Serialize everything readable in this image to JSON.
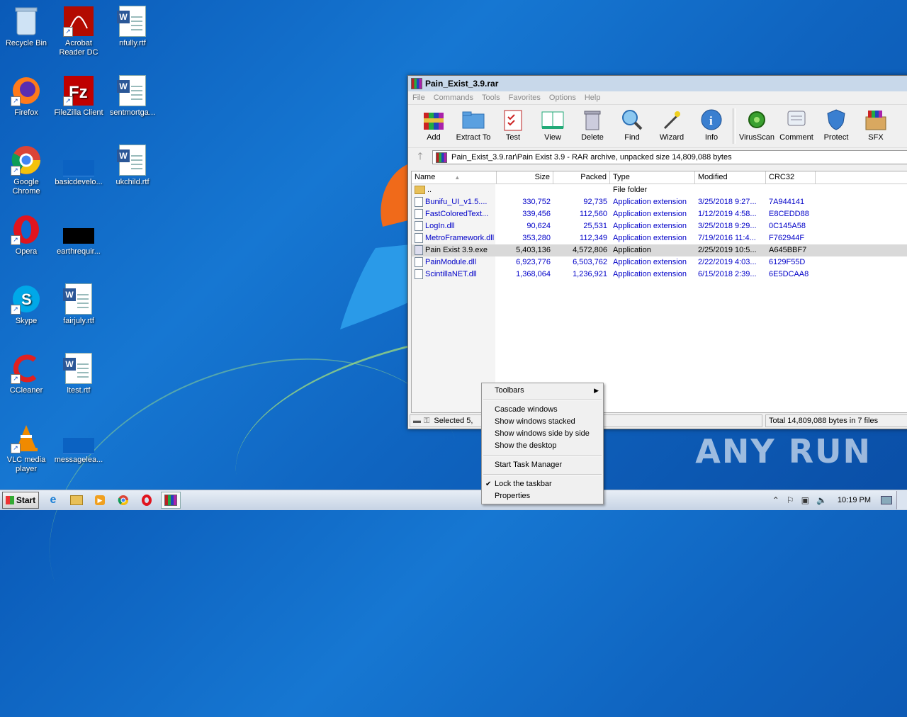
{
  "desktop": {
    "icons": [
      {
        "label": "Recycle Bin"
      },
      {
        "label": "Acrobat Reader DC"
      },
      {
        "label": "nfully.rtf"
      },
      {
        "label": "Firefox"
      },
      {
        "label": "FileZilla Client"
      },
      {
        "label": "sentmortga..."
      },
      {
        "label": "Google Chrome"
      },
      {
        "label": "basicdevelo..."
      },
      {
        "label": "ukchild.rtf"
      },
      {
        "label": "Opera"
      },
      {
        "label": "earthrequir..."
      },
      {
        "label": "Skype"
      },
      {
        "label": "fairjuly.rtf"
      },
      {
        "label": "CCleaner"
      },
      {
        "label": "ltest.rtf"
      },
      {
        "label": "VLC media player"
      },
      {
        "label": "messagelea..."
      }
    ]
  },
  "window": {
    "title": "Pain_Exist_3.9.rar",
    "menu": [
      "File",
      "Commands",
      "Tools",
      "Favorites",
      "Options",
      "Help"
    ],
    "toolbar": [
      {
        "label": "Add",
        "icon": "add-archive-icon"
      },
      {
        "label": "Extract To",
        "icon": "extract-folder-icon"
      },
      {
        "label": "Test",
        "icon": "test-clipboard-icon"
      },
      {
        "label": "View",
        "icon": "view-book-icon"
      },
      {
        "label": "Delete",
        "icon": "trash-icon"
      },
      {
        "label": "Find",
        "icon": "magnifier-icon"
      },
      {
        "label": "Wizard",
        "icon": "wand-icon"
      },
      {
        "label": "Info",
        "icon": "info-icon"
      },
      {
        "label": "VirusScan",
        "icon": "virus-icon"
      },
      {
        "label": "Comment",
        "icon": "comment-icon"
      },
      {
        "label": "Protect",
        "icon": "shield-icon"
      },
      {
        "label": "SFX",
        "icon": "sfx-box-icon"
      }
    ],
    "path": "Pain_Exist_3.9.rar\\Pain Exist 3.9 - RAR archive, unpacked size 14,809,088 bytes",
    "columns": [
      "Name",
      "Size",
      "Packed",
      "Type",
      "Modified",
      "CRC32"
    ],
    "files": [
      {
        "name": "..",
        "size": "",
        "packed": "",
        "type": "File folder",
        "modified": "",
        "crc": ""
      },
      {
        "name": "Bunifu_UI_v1.5....",
        "size": "330,752",
        "packed": "92,735",
        "type": "Application extension",
        "modified": "3/25/2018 9:27...",
        "crc": "7A944141"
      },
      {
        "name": "FastColoredText...",
        "size": "339,456",
        "packed": "112,560",
        "type": "Application extension",
        "modified": "1/12/2019 4:58...",
        "crc": "E8CEDD88"
      },
      {
        "name": "LogIn.dll",
        "size": "90,624",
        "packed": "25,531",
        "type": "Application extension",
        "modified": "3/25/2018 9:29...",
        "crc": "0C145A58"
      },
      {
        "name": "MetroFramework.dll",
        "size": "353,280",
        "packed": "112,349",
        "type": "Application extension",
        "modified": "7/19/2016 11:4...",
        "crc": "F762944F"
      },
      {
        "name": "Pain Exist 3.9.exe",
        "size": "5,403,136",
        "packed": "4,572,806",
        "type": "Application",
        "modified": "2/25/2019 10:5...",
        "crc": "A645BBF7"
      },
      {
        "name": "PainModule.dll",
        "size": "6,923,776",
        "packed": "6,503,762",
        "type": "Application extension",
        "modified": "2/22/2019 4:03...",
        "crc": "6129F55D"
      },
      {
        "name": "ScintillaNET.dll",
        "size": "1,368,064",
        "packed": "1,236,921",
        "type": "Application extension",
        "modified": "6/15/2018 2:39...",
        "crc": "6E5DCAA8"
      }
    ],
    "status_left": "Selected 5,",
    "status_right": "Total 14,809,088 bytes in 7 files"
  },
  "context_menu": {
    "toolbars": "Toolbars",
    "cascade": "Cascade windows",
    "stacked": "Show windows stacked",
    "side_by_side": "Show windows side by side",
    "show_desktop": "Show the desktop",
    "task_manager": "Start Task Manager",
    "lock": "Lock the taskbar",
    "properties": "Properties"
  },
  "taskbar": {
    "start": "Start",
    "clock": "10:19 PM"
  },
  "watermark": "ANY RUN"
}
